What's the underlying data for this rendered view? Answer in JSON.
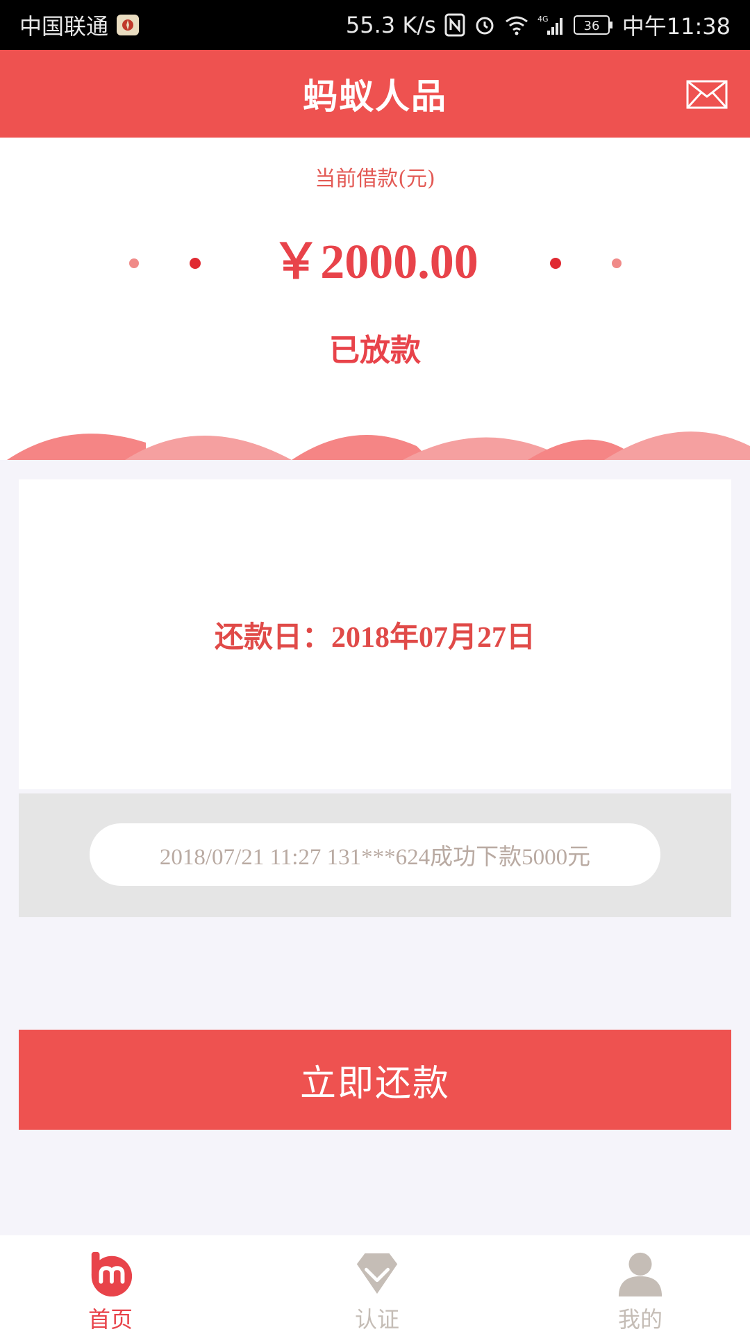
{
  "status_bar": {
    "carrier": "中国联通",
    "speed": "55.3 K/s",
    "network": "4G",
    "battery": "36",
    "time": "中午11:38"
  },
  "header": {
    "title": "蚂蚁人品",
    "mail_icon": "envelope-icon",
    "color": "#ee5250"
  },
  "loan": {
    "caption": "当前借款(元)",
    "amount": "￥2000.00",
    "status": "已放款"
  },
  "due": {
    "text": "还款日：2018年07月27日"
  },
  "ticker": {
    "message": "2018/07/21 11:27 131***624成功下款5000元"
  },
  "actions": {
    "repay_label": "立即还款"
  },
  "nav": {
    "items": [
      {
        "label": "首页",
        "icon": "home-logo-icon",
        "active": true,
        "color": "#e8434a"
      },
      {
        "label": "认证",
        "icon": "diamond-check-icon",
        "active": false,
        "color": "#c5bdb6"
      },
      {
        "label": "我的",
        "icon": "user-icon",
        "active": false,
        "color": "#c5bdb6"
      }
    ]
  }
}
